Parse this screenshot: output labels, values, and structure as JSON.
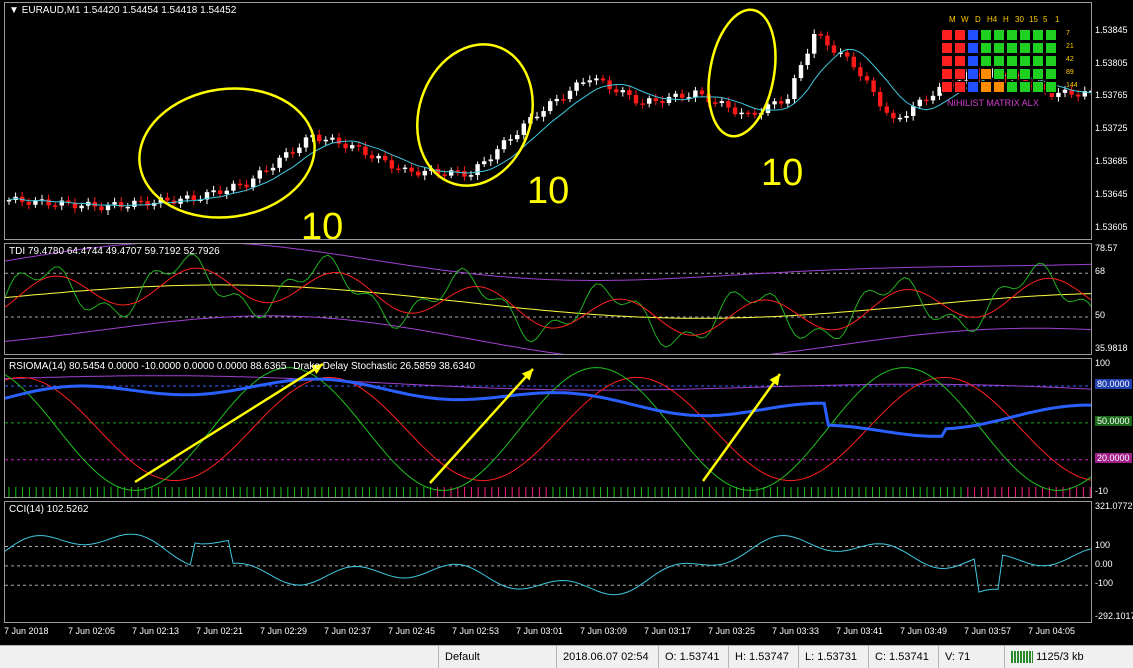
{
  "chart_data": [
    {
      "type": "candlestick",
      "title": "EURAUD,M1  1.54420 1.54454 1.54418 1.54452",
      "price_ticks": [
        "1.53845",
        "1.53805",
        "1.53765",
        "1.53725",
        "1.53685",
        "1.53645",
        "1.53605"
      ],
      "ylim": [
        1.5359,
        1.5388
      ],
      "colors": {
        "up": "#ffffff",
        "down": "#ff1a1a",
        "ma": "#40c8e0",
        "annotation": "#ffff00"
      },
      "annotations": [
        "10",
        "10",
        "10"
      ]
    },
    {
      "type": "line",
      "title": "TDI 79.4780 64.4744 49.4707 59.7192 52.7926",
      "ticks": [
        "78.57",
        "68",
        "50",
        "35.9818"
      ],
      "levels": [
        68,
        50
      ],
      "ylim": [
        34,
        80
      ]
    },
    {
      "type": "line",
      "title": "RSIOMA(14) 80.5454 0.0000 -10.0000 0.0000 0.0000 88.6365",
      "subtitle": "Drake Delay Stochastic 26.5859 38.6340",
      "ticks": [
        "100",
        "80.0000",
        "50.0000",
        "20.0000",
        "-10"
      ],
      "levels": [
        80,
        50,
        20
      ],
      "ylim": [
        -12,
        102
      ]
    },
    {
      "type": "line",
      "title": "CCI(14) 102.5262",
      "ticks": [
        "321.0772",
        "100",
        "0.00",
        "-100",
        "-292.1017"
      ],
      "levels": [
        100,
        0,
        -100
      ],
      "ylim": [
        -300,
        330
      ]
    }
  ],
  "xaxis": [
    "7 Jun 2018",
    "7 Jun 02:05",
    "7 Jun 02:13",
    "7 Jun 02:21",
    "7 Jun 02:29",
    "7 Jun 02:37",
    "7 Jun 02:45",
    "7 Jun 02:53",
    "7 Jun 03:01",
    "7 Jun 03:09",
    "7 Jun 03:17",
    "7 Jun 03:25",
    "7 Jun 03:33",
    "7 Jun 03:41",
    "7 Jun 03:49",
    "7 Jun 03:57",
    "7 Jun 04:05"
  ],
  "matrix": {
    "timeframes": [
      "M",
      "W",
      "D",
      "H4",
      "H",
      "30",
      "15",
      "5",
      "1"
    ],
    "rows": [
      "7",
      "21",
      "42",
      "89",
      "144"
    ],
    "indicator_name": "NIHILIST MATRIX ALX"
  },
  "status": {
    "profile": "Default",
    "datetime": "2018.06.07 02:54",
    "open": "O: 1.53741",
    "high": "H: 1.53747",
    "low": "L: 1.53731",
    "close": "C: 1.53741",
    "volume": "V: 71",
    "traffic": "1125/3 kb"
  }
}
